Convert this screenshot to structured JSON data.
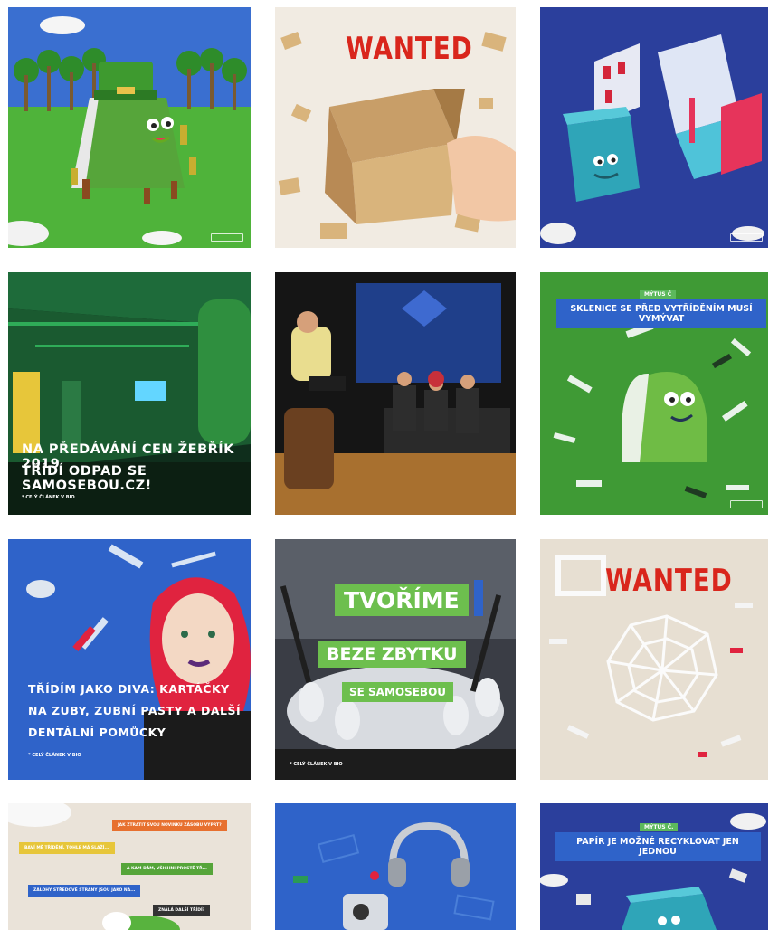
{
  "tiles": {
    "t2": {
      "headline": "WANTED"
    },
    "t4": {
      "caption_line1": "NA PŘEDÁVÁNÍ CEN ŽEBŘÍK 2019",
      "caption_line2": "TŘÍDÍ ODPAD SE SAMOSEBOU.CZ!",
      "small": "* CELÝ ČLÁNEK V BIO"
    },
    "t6": {
      "badge": "MÝTUS Č",
      "banner": "SKLENICE SE PŘED VYTŘÍDĚNÍM MUSÍ VYMÝVAT"
    },
    "t7": {
      "line1": "TŘÍDÍM JAKO DIVA: KARTÁČKY",
      "line2": "NA ZUBY, ZUBNÍ PASTY A DALŠÍ",
      "line3": "DENTÁLNÍ POMŮCKY",
      "small": "* CELÝ ČLÁNEK V BIO"
    },
    "t8": {
      "line1": "TVOŘÍME",
      "line2": "BEZE ZBYTKU",
      "line3": "SE SAMOSEBOU",
      "small": "* CELÝ ČLÁNEK V BIO"
    },
    "t9": {
      "headline": "WANTED"
    },
    "t10": {
      "bubbles": [
        "JAK ZTRATIT SVOU NOVINKU ZÁSOBU VÝPRT?",
        "BAVÍ MĚ TŘÍDĚNÍ, TOHLE MÁ SLAŽÍ...",
        "A KAM DÁM, VŠICHNI PROSTĚ TŘ...",
        "ZÁLOHY STŘEDOVÉ STRANY JSOU JAKO NA...",
        "ZNÁLÁ DALŠÍ TŘÍDÍ?"
      ]
    },
    "t12": {
      "badge": "MÝTUS Č.",
      "banner": "PAPÍR JE MOŽNÉ RECYKLOVAT JEN JEDNOU"
    }
  },
  "colors": {
    "green": "#3f9a35",
    "blue": "#2f63c9",
    "navy": "#2b3f9c",
    "red": "#d9261c",
    "cream": "#f1ebe2"
  }
}
